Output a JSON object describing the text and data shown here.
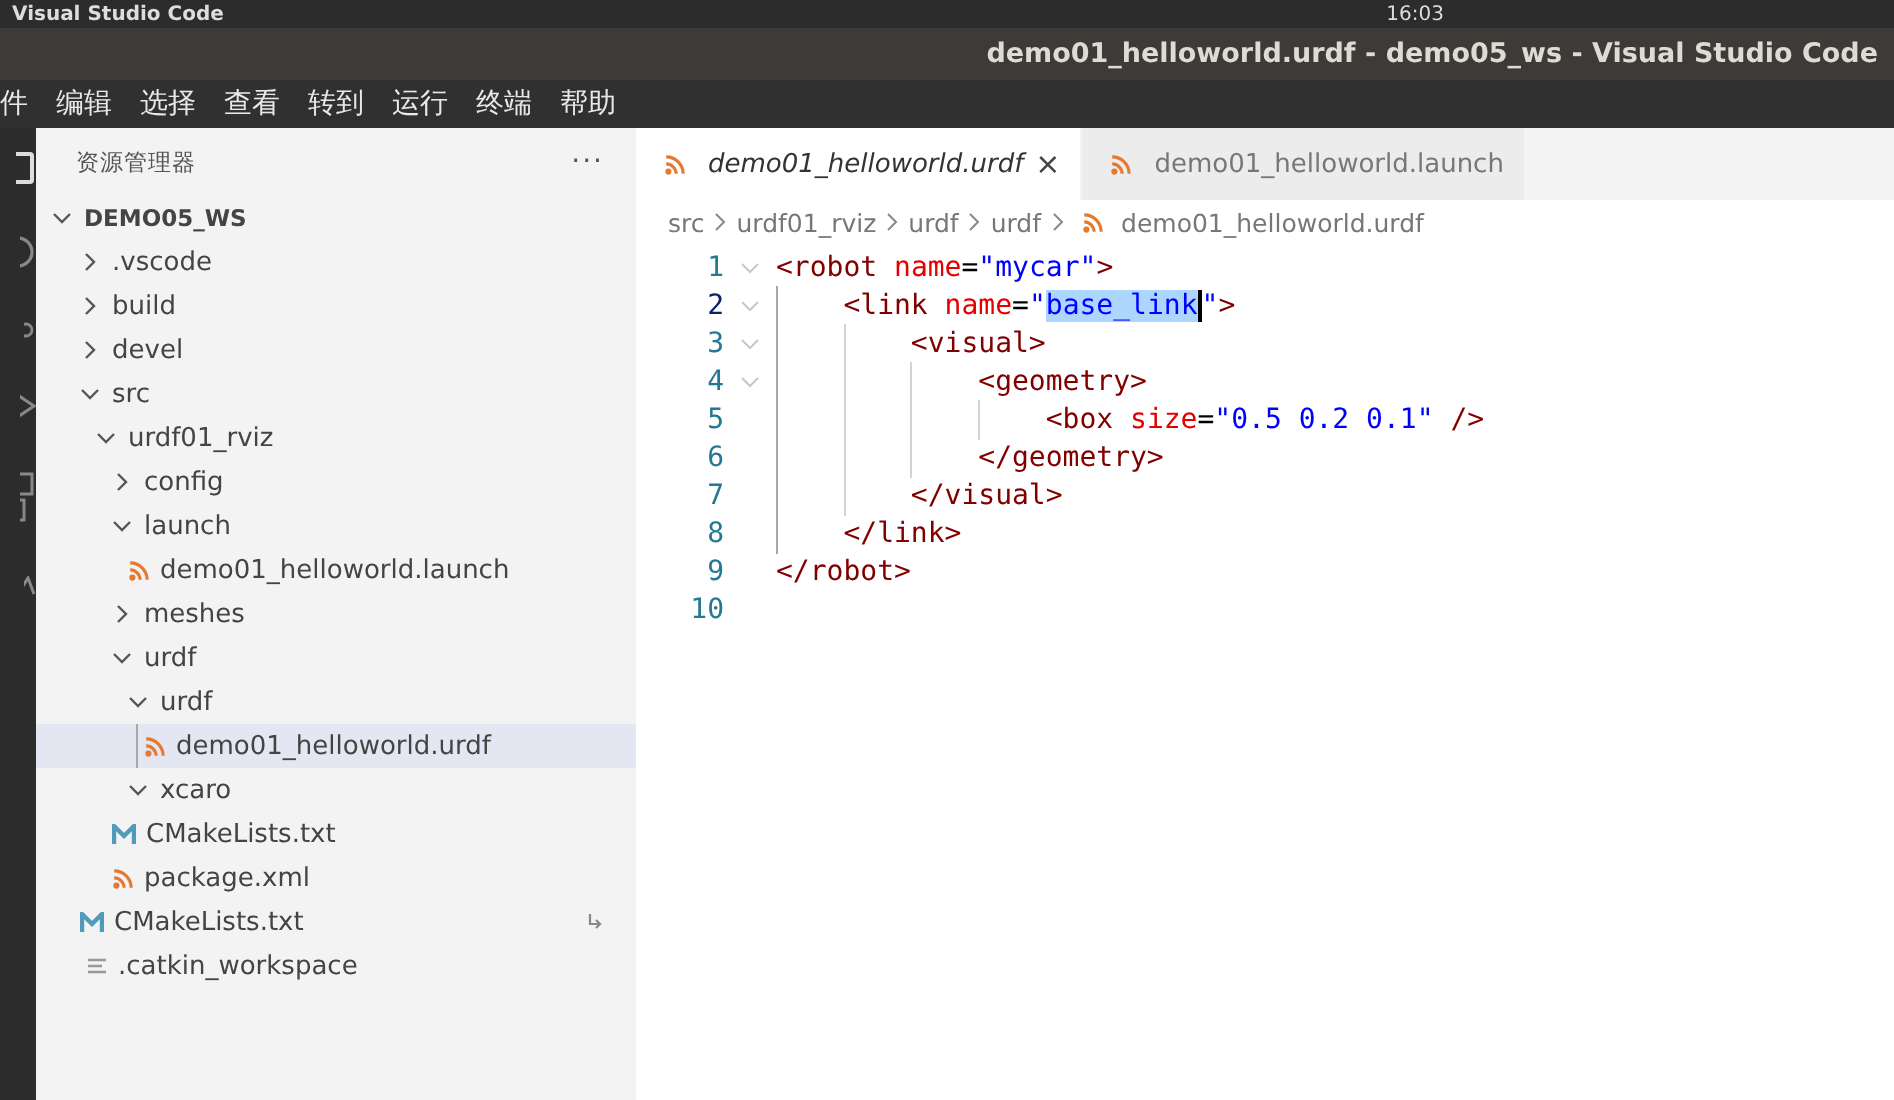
{
  "top_bar": {
    "app_name": "Visual Studio Code",
    "clock": "16:03"
  },
  "window": {
    "title": "demo01_helloworld.urdf - demo05_ws - Visual Studio Code"
  },
  "menu": [
    "件",
    "编辑",
    "选择",
    "查看",
    "转到",
    "运行",
    "终端",
    "帮助"
  ],
  "sidebar": {
    "title": "资源管理器",
    "more": "···",
    "tree": [
      {
        "label": "DEMO05_WS",
        "kind": "root",
        "expanded": true,
        "selected": false,
        "symlink": false,
        "children": [
          {
            "label": ".vscode",
            "kind": "folder",
            "expanded": false,
            "selected": false,
            "symlink": false
          },
          {
            "label": "build",
            "kind": "folder",
            "expanded": false,
            "selected": false,
            "symlink": false
          },
          {
            "label": "devel",
            "kind": "folder",
            "expanded": false,
            "selected": false,
            "symlink": false
          },
          {
            "label": "src",
            "kind": "folder",
            "expanded": true,
            "selected": false,
            "symlink": false,
            "children": [
              {
                "label": "urdf01_rviz",
                "kind": "folder",
                "expanded": true,
                "selected": false,
                "symlink": false,
                "children": [
                  {
                    "label": "config",
                    "kind": "folder",
                    "expanded": false,
                    "selected": false,
                    "symlink": false
                  },
                  {
                    "label": "launch",
                    "kind": "folder",
                    "expanded": true,
                    "selected": false,
                    "symlink": false,
                    "children": [
                      {
                        "label": "demo01_helloworld.launch",
                        "kind": "xml",
                        "selected": false,
                        "symlink": false
                      }
                    ]
                  },
                  {
                    "label": "meshes",
                    "kind": "folder",
                    "expanded": false,
                    "selected": false,
                    "symlink": false
                  },
                  {
                    "label": "urdf",
                    "kind": "folder",
                    "expanded": true,
                    "selected": false,
                    "symlink": false,
                    "children": [
                      {
                        "label": "urdf",
                        "kind": "folder",
                        "expanded": true,
                        "selected": false,
                        "symlink": false,
                        "children": [
                          {
                            "label": "demo01_helloworld.urdf",
                            "kind": "xml",
                            "selected": true,
                            "symlink": false
                          }
                        ]
                      },
                      {
                        "label": "xcaro",
                        "kind": "folder",
                        "expanded": true,
                        "selected": false,
                        "symlink": false
                      }
                    ]
                  },
                  {
                    "label": "CMakeLists.txt",
                    "kind": "cmake",
                    "selected": false,
                    "symlink": false
                  },
                  {
                    "label": "package.xml",
                    "kind": "xml",
                    "selected": false,
                    "symlink": false
                  }
                ]
              }
            ]
          },
          {
            "label": "CMakeLists.txt",
            "kind": "cmake",
            "selected": false,
            "symlink": true
          },
          {
            "label": ".catkin_workspace",
            "kind": "text",
            "selected": false,
            "symlink": false
          }
        ]
      }
    ]
  },
  "tabs": [
    {
      "label": "demo01_helloworld.urdf",
      "selected": true,
      "preview": true,
      "close": "×"
    },
    {
      "label": "demo01_helloworld.launch",
      "selected": false,
      "preview": false
    }
  ],
  "breadcrumbs": [
    {
      "label": "src",
      "kind": "folder"
    },
    {
      "label": "urdf01_rviz",
      "kind": "folder"
    },
    {
      "label": "urdf",
      "kind": "folder"
    },
    {
      "label": "urdf",
      "kind": "folder"
    },
    {
      "label": "demo01_helloworld.urdf",
      "kind": "xml"
    }
  ],
  "editor": {
    "lines": [
      {
        "number": "1",
        "current": false,
        "foldable": true,
        "tokens": [
          {
            "kind": "tag",
            "text": "<robot ",
            "selected": false
          },
          {
            "kind": "attr",
            "text": "name",
            "selected": false
          },
          {
            "kind": "plain",
            "text": "=",
            "selected": false
          },
          {
            "kind": "string",
            "text": "\"mycar\"",
            "selected": false
          },
          {
            "kind": "tag",
            "text": ">",
            "selected": false
          }
        ]
      },
      {
        "number": "2",
        "current": true,
        "foldable": true,
        "tokens": [
          {
            "kind": "tag",
            "text": "    <link ",
            "selected": false
          },
          {
            "kind": "attr",
            "text": "name",
            "selected": false
          },
          {
            "kind": "plain",
            "text": "=",
            "selected": false
          },
          {
            "kind": "string",
            "text": "\"",
            "selected": false
          },
          {
            "kind": "string",
            "text": "base_link",
            "selected": true
          },
          {
            "kind": "string",
            "text": "\"",
            "selected": false
          },
          {
            "kind": "tag",
            "text": ">",
            "selected": false
          }
        ]
      },
      {
        "number": "3",
        "current": false,
        "foldable": true,
        "tokens": [
          {
            "kind": "tag",
            "text": "        <visual>",
            "selected": false
          }
        ]
      },
      {
        "number": "4",
        "current": false,
        "foldable": true,
        "tokens": [
          {
            "kind": "tag",
            "text": "            <geometry>",
            "selected": false
          }
        ]
      },
      {
        "number": "5",
        "current": false,
        "foldable": false,
        "tokens": [
          {
            "kind": "tag",
            "text": "                <box ",
            "selected": false
          },
          {
            "kind": "attr",
            "text": "size",
            "selected": false
          },
          {
            "kind": "plain",
            "text": "=",
            "selected": false
          },
          {
            "kind": "string",
            "text": "\"0.5 0.2 0.1\" ",
            "selected": false
          },
          {
            "kind": "tag",
            "text": "/>",
            "selected": false
          }
        ]
      },
      {
        "number": "6",
        "current": false,
        "foldable": false,
        "tokens": [
          {
            "kind": "tag",
            "text": "            </geometry>",
            "selected": false
          }
        ]
      },
      {
        "number": "7",
        "current": false,
        "foldable": false,
        "tokens": [
          {
            "kind": "tag",
            "text": "        </visual>",
            "selected": false
          }
        ]
      },
      {
        "number": "8",
        "current": false,
        "foldable": false,
        "tokens": [
          {
            "kind": "tag",
            "text": "    </link>",
            "selected": false
          }
        ]
      },
      {
        "number": "9",
        "current": false,
        "foldable": false,
        "tokens": [
          {
            "kind": "tag",
            "text": "</robot>",
            "selected": false
          }
        ]
      },
      {
        "number": "10",
        "current": false,
        "foldable": false
      }
    ]
  }
}
